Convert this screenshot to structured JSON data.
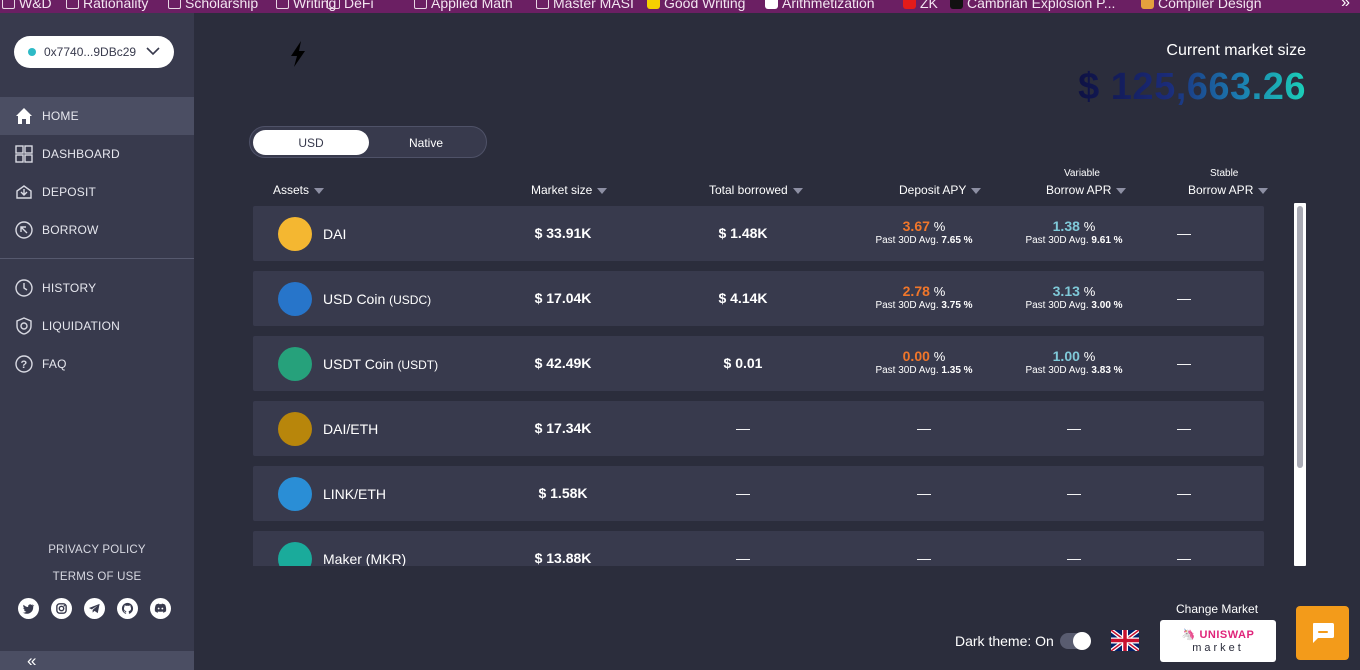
{
  "bookmarks": [
    {
      "label": "W&D",
      "icon": "folder-icon"
    },
    {
      "label": "Rationality",
      "icon": "folder-icon"
    },
    {
      "label": "Scholarship",
      "icon": "folder-icon"
    },
    {
      "label": "Writing",
      "icon": "folder-icon"
    },
    {
      "label": "DeFi",
      "icon": "folder-icon"
    },
    {
      "label": "Applied Math",
      "icon": "folder-icon"
    },
    {
      "label": "Master MASI",
      "icon": "folder-icon"
    },
    {
      "label": "Good Writing",
      "icon": "smiley-favicon"
    },
    {
      "label": "Arithmetization",
      "icon": "page-favicon"
    },
    {
      "label": "ZK",
      "icon": "youtube-favicon"
    },
    {
      "label": "Cambrian Explosion P...",
      "icon": "medium-favicon"
    },
    {
      "label": "Compiler Design",
      "icon": "bars-favicon"
    }
  ],
  "bookmarks_more": "»",
  "wallet": {
    "address": "0x7740...9DBc29"
  },
  "nav": [
    {
      "label": "HOME",
      "icon": "home-icon"
    },
    {
      "label": "DASHBOARD",
      "icon": "dashboard-icon"
    },
    {
      "label": "DEPOSIT",
      "icon": "deposit-icon"
    },
    {
      "label": "BORROW",
      "icon": "borrow-icon"
    },
    {
      "label": "HISTORY",
      "icon": "history-icon"
    },
    {
      "label": "LIQUIDATION",
      "icon": "shield-icon"
    },
    {
      "label": "FAQ",
      "icon": "question-icon"
    }
  ],
  "footer": {
    "privacy": "PRIVACY POLICY",
    "terms": "TERMS OF USE",
    "collapse": "«"
  },
  "socials": [
    "twitter-icon",
    "instagram-icon",
    "telegram-icon",
    "github-icon",
    "discord-icon"
  ],
  "market": {
    "label": "Current market size",
    "value": "$ 125,663.26"
  },
  "currency_toggle": {
    "usd": "USD",
    "native": "Native",
    "selected": "USD"
  },
  "table": {
    "headers": {
      "assets": "Assets",
      "market_size": "Market size",
      "total_borrowed": "Total borrowed",
      "deposit_apy": "Deposit APY",
      "variable_top": "Variable",
      "variable": "Borrow APR",
      "stable_top": "Stable",
      "stable": "Borrow APR"
    },
    "avg_label": "Past 30D Avg.",
    "pct": "%",
    "dash": "—",
    "rows": [
      {
        "name": "DAI",
        "symbol": "",
        "market_size": "$ 33.91K",
        "total_borrowed": "$ 1.48K",
        "deposit_apy": "3.67",
        "deposit_avg": "7.65 %",
        "variable_apr": "1.38",
        "variable_avg": "9.61 %",
        "stable": "—",
        "icon_color": "#f4b731"
      },
      {
        "name": "USD Coin",
        "symbol": "(USDC)",
        "market_size": "$ 17.04K",
        "total_borrowed": "$ 4.14K",
        "deposit_apy": "2.78",
        "deposit_avg": "3.75 %",
        "variable_apr": "3.13",
        "variable_avg": "3.00 %",
        "stable": "—",
        "icon_color": "#2775ca"
      },
      {
        "name": "USDT Coin",
        "symbol": "(USDT)",
        "market_size": "$ 42.49K",
        "total_borrowed": "$ 0.01",
        "deposit_apy": "0.00",
        "deposit_avg": "1.35 %",
        "variable_apr": "1.00",
        "variable_avg": "3.83 %",
        "stable": "—",
        "icon_color": "#26a17b"
      },
      {
        "name": "DAI/ETH",
        "symbol": "",
        "market_size": "$ 17.34K",
        "total_borrowed": "—",
        "deposit_apy": "—",
        "variable_apr": "—",
        "stable": "—",
        "icon_color": "#b8860b"
      },
      {
        "name": "LINK/ETH",
        "symbol": "",
        "market_size": "$ 1.58K",
        "total_borrowed": "—",
        "deposit_apy": "—",
        "variable_apr": "—",
        "stable": "—",
        "icon_color": "#2a8ed6"
      },
      {
        "name": "Maker (MKR)",
        "symbol": "",
        "market_size": "$ 13.88K",
        "total_borrowed": "—",
        "deposit_apy": "—",
        "variable_apr": "—",
        "stable": "—",
        "icon_color": "#1aab9b"
      }
    ]
  },
  "bottom": {
    "dark_theme": "Dark theme: On",
    "change_market": "Change Market",
    "market_brand": "UNISWAP",
    "market_sub": "market"
  },
  "colors": {
    "accent_orange": "#f0762a",
    "accent_teal": "#7fc9d8",
    "chat": "#f39b1a"
  }
}
